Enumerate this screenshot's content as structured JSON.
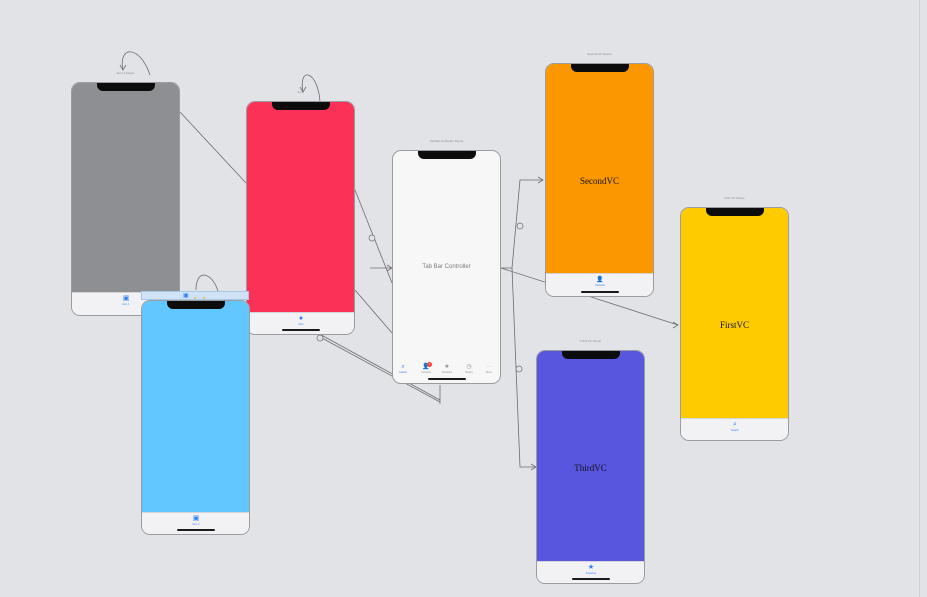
{
  "storyboard": {
    "scenes": [
      {
        "key": "gray",
        "title": "Item 1 Scene",
        "color": "#8e8f93",
        "label": "",
        "tab_icon": "square-icon",
        "tab_glyph": "▣",
        "tab_label": "Item 1"
      },
      {
        "key": "red",
        "title": "Item",
        "color": "#fc3157",
        "label": "",
        "tab_icon": "circle-icon",
        "tab_glyph": "●",
        "tab_label": "Item"
      },
      {
        "key": "blue",
        "title": "Item 2 Scene",
        "color": "#63c7ff",
        "label": "",
        "tab_icon": "square-icon",
        "tab_glyph": "▣",
        "tab_label": "Item 2"
      },
      {
        "key": "orange",
        "title": "Second VC Scene",
        "color": "#fb9700",
        "label": "SecondVC",
        "tab_icon": "contacts-icon",
        "tab_glyph": "👤",
        "tab_label": "Contacts"
      },
      {
        "key": "yellow",
        "title": "First VC Scene",
        "color": "#fecb00",
        "label": "FirstVC",
        "tab_icon": "search-icon",
        "tab_glyph": "⌕",
        "tab_label": "Search"
      },
      {
        "key": "purple",
        "title": "Third VC Scene",
        "color": "#5855de",
        "label": "ThirdVC",
        "tab_icon": "star-icon",
        "tab_glyph": "★",
        "tab_label": "Favorites"
      }
    ],
    "tab_bar_controller": {
      "title": "Tab Bar Controller Scene",
      "label": "Tab Bar Controller",
      "tabs": [
        {
          "icon": "search-icon",
          "glyph": "⌕",
          "label": "Search",
          "active": true
        },
        {
          "icon": "contacts-icon",
          "glyph": "👤",
          "label": "Contacts",
          "badge": "1"
        },
        {
          "icon": "star-icon",
          "glyph": "★",
          "label": "Favorites"
        },
        {
          "icon": "history-icon",
          "glyph": "◷",
          "label": "History"
        },
        {
          "icon": "more-icon",
          "glyph": "···",
          "label": "More"
        }
      ]
    },
    "scene_dock": {
      "icons": [
        {
          "name": "view-controller-icon",
          "glyph": "▣",
          "color": "#2f7cf6"
        },
        {
          "name": "first-responder-icon",
          "glyph": "●",
          "color": "#f5a623"
        },
        {
          "name": "exit-icon",
          "glyph": "●",
          "color": "#f5a623"
        }
      ]
    },
    "colors": {
      "canvas": "#e2e3e7",
      "segue": "#6c6d72",
      "tint": "#2f7cf6"
    }
  }
}
